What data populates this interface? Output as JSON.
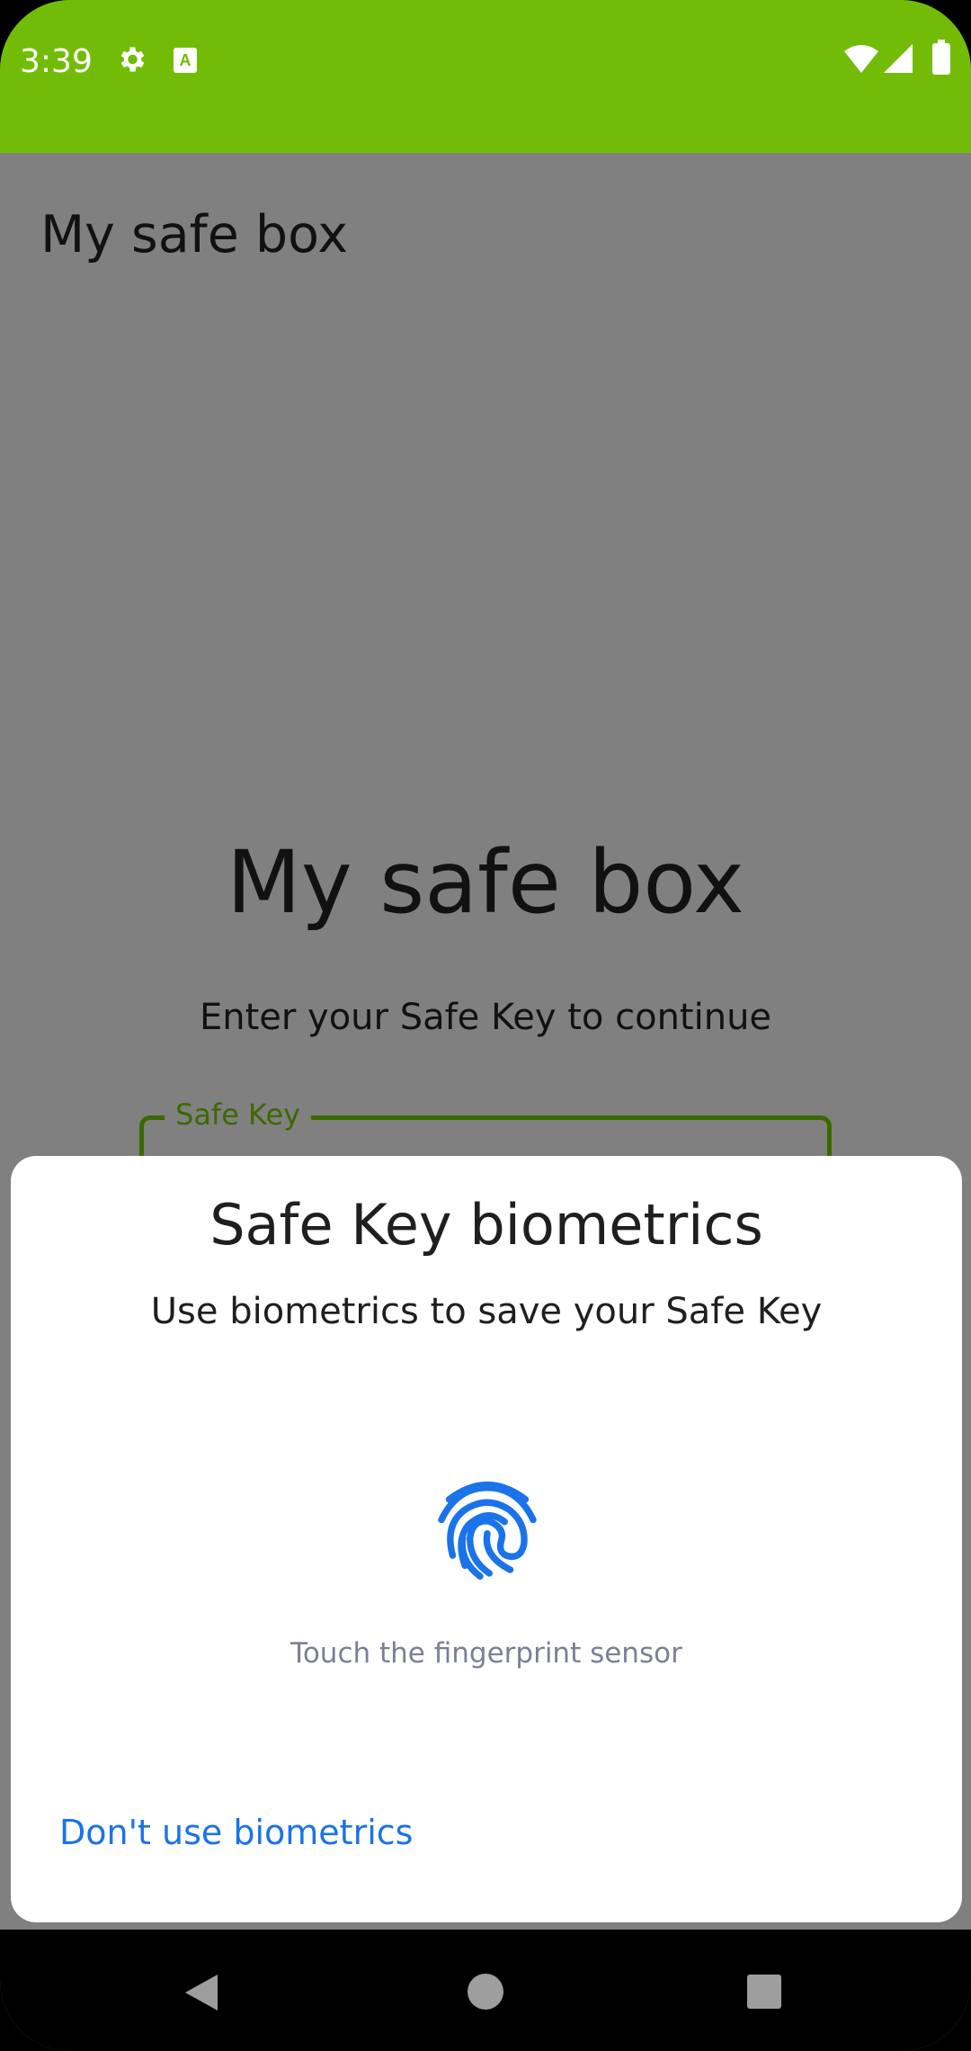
{
  "status_bar": {
    "time": "3:39",
    "background_color": "#72bc07",
    "left_icons": [
      "gear-icon",
      "text-a-icon"
    ],
    "right_icons": [
      "wifi-icon",
      "signal-icon",
      "battery-icon"
    ]
  },
  "app_bar": {
    "title": "My safe box"
  },
  "main": {
    "heading": "My safe box",
    "subtitle": "Enter your Safe Key to continue",
    "safe_key_field": {
      "label": "Safe Key",
      "value": "",
      "accent_color": "#3d6800"
    }
  },
  "biometric_dialog": {
    "title": "Safe Key biometrics",
    "subtitle": "Use biometrics to save your Safe Key",
    "icon": "fingerprint-icon",
    "icon_color": "#1a73e8",
    "hint": "Touch the fingerprint sensor",
    "negative_button": "Don't use biometrics"
  },
  "nav_bar": {
    "buttons": [
      "back-icon",
      "home-icon",
      "recents-icon"
    ]
  }
}
